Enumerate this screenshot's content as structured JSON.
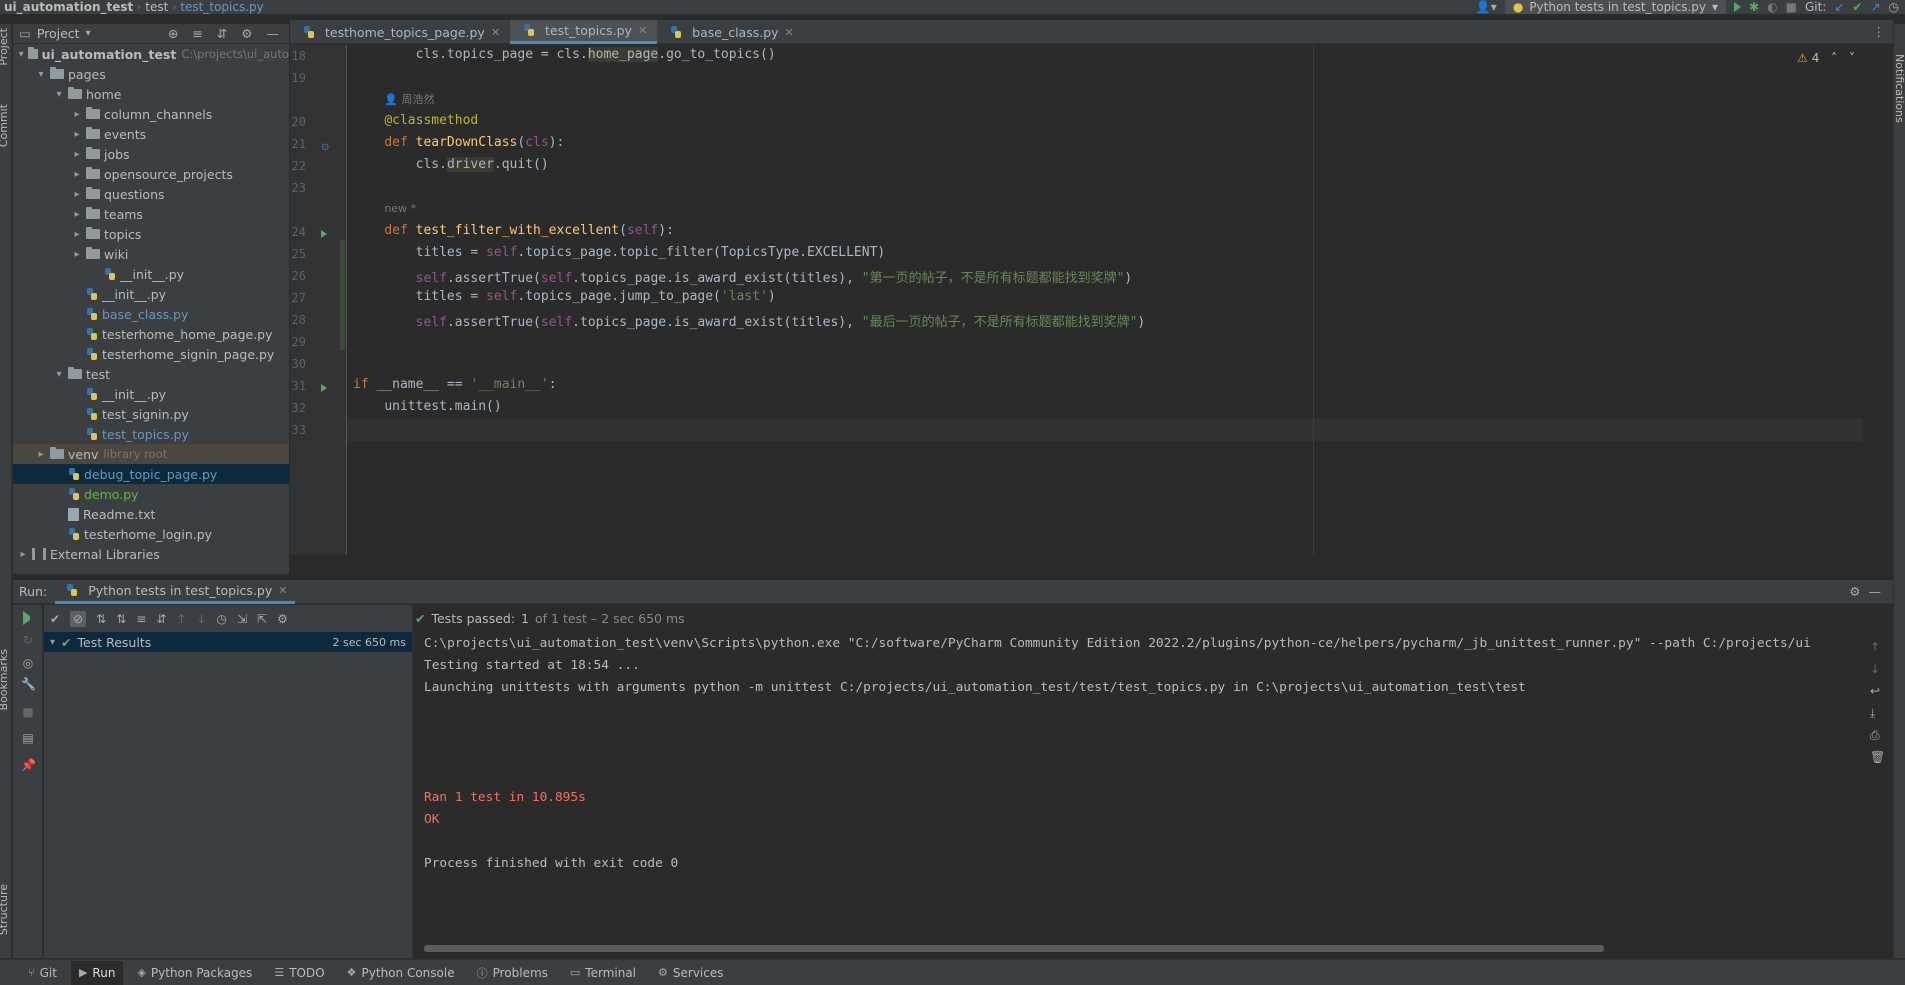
{
  "navbar": {
    "project": "ui_automation_test",
    "folder": "test",
    "file": "test_topics.py",
    "run_config": "Python tests in test_topics.py",
    "git_label": "Git:"
  },
  "left_stripe": {
    "project": "Project",
    "commit": "Commit",
    "bookmarks": "Bookmarks",
    "structure": "Structure"
  },
  "right_stripe": {
    "notifications": "Notifications"
  },
  "project_panel": {
    "title": "Project",
    "root_name": "ui_automation_test",
    "root_path": "C:\\projects\\ui_auto",
    "items": [
      {
        "label": "pages",
        "type": "folder",
        "depth": 1,
        "open": true
      },
      {
        "label": "home",
        "type": "folder",
        "depth": 2,
        "open": true
      },
      {
        "label": "column_channels",
        "type": "folder",
        "depth": 3,
        "open": false
      },
      {
        "label": "events",
        "type": "folder",
        "depth": 3,
        "open": false
      },
      {
        "label": "jobs",
        "type": "folder",
        "depth": 3,
        "open": false
      },
      {
        "label": "opensource_projects",
        "type": "folder",
        "depth": 3,
        "open": false
      },
      {
        "label": "questions",
        "type": "folder",
        "depth": 3,
        "open": false
      },
      {
        "label": "teams",
        "type": "folder",
        "depth": 3,
        "open": false
      },
      {
        "label": "topics",
        "type": "folder",
        "depth": 3,
        "open": false
      },
      {
        "label": "wiki",
        "type": "folder",
        "depth": 3,
        "open": false
      },
      {
        "label": "__init__.py",
        "type": "py",
        "depth": 4
      },
      {
        "label": "__init__.py",
        "type": "py",
        "depth": 3
      },
      {
        "label": "base_class.py",
        "type": "py",
        "depth": 3,
        "color": "blue"
      },
      {
        "label": "testerhome_home_page.py",
        "type": "py",
        "depth": 3
      },
      {
        "label": "testerhome_signin_page.py",
        "type": "py",
        "depth": 3
      },
      {
        "label": "test",
        "type": "folder",
        "depth": 2,
        "open": true
      },
      {
        "label": "__init__.py",
        "type": "py",
        "depth": 3
      },
      {
        "label": "test_signin.py",
        "type": "py",
        "depth": 3
      },
      {
        "label": "test_topics.py",
        "type": "py",
        "depth": 3,
        "color": "blue"
      },
      {
        "label": "venv",
        "type": "folder",
        "depth": 1,
        "open": false,
        "suffix": "library root",
        "state": "highlight"
      },
      {
        "label": "debug_topic_page.py",
        "type": "py",
        "depth": 2,
        "color": "blue",
        "state": "selected"
      },
      {
        "label": "demo.py",
        "type": "py",
        "depth": 2,
        "color": "green"
      },
      {
        "label": "Readme.txt",
        "type": "txt",
        "depth": 2
      },
      {
        "label": "testerhome_login.py",
        "type": "py",
        "depth": 2
      },
      {
        "label": "External Libraries",
        "type": "lib",
        "depth": 0,
        "open": false
      }
    ]
  },
  "editor_tabs": [
    {
      "label": "testhome_topics_page.py",
      "active": false
    },
    {
      "label": "test_topics.py",
      "active": true
    },
    {
      "label": "base_class.py",
      "active": false
    }
  ],
  "editor": {
    "warnings": "4",
    "author_hint": "周浩然",
    "new_hint": "new *",
    "line_numbers": [
      "18",
      "19",
      "20",
      "21",
      "22",
      "23",
      "24",
      "25",
      "26",
      "27",
      "28",
      "29",
      "30",
      "31",
      "32",
      "33"
    ],
    "code": {
      "l18_a": "cls.topics_page = cls.",
      "l18_b": "home_page",
      "l18_c": ".go_to_topics()",
      "l20": "@classmethod",
      "l21_kw": "def ",
      "l21_fn": "tearDownClass",
      "l21_a": "(",
      "l21_self": "cls",
      "l21_b": "):",
      "l22_a": "cls.",
      "l22_b": "driver",
      "l22_c": ".quit()",
      "l24_kw": "def ",
      "l24_fn": "test_filter_with_excellent",
      "l24_a": "(",
      "l24_self": "self",
      "l24_b": "):",
      "l25_a": "titles = ",
      "l25_self": "self",
      "l25_b": ".topics_page.topic_filter(TopicsType.EXCELLENT)",
      "l26_self": "self",
      "l26_a": ".assertTrue(",
      "l26_self2": "self",
      "l26_b": ".topics_page.is_award_exist(titles), ",
      "l26_str": "\"第一页的帖子，不是所有标题都能找到奖牌\"",
      "l26_c": ")",
      "l27_a": "titles = ",
      "l27_self": "self",
      "l27_b": ".topics_page.jump_to_page(",
      "l27_str": "'last'",
      "l27_c": ")",
      "l28_self": "self",
      "l28_a": ".assertTrue(",
      "l28_self2": "self",
      "l28_b": ".topics_page.is_award_exist(titles), ",
      "l28_str": "\"最后一页的帖子，不是所有标题都能找到奖牌\"",
      "l28_c": ")",
      "l31_kw": "if ",
      "l31_a": "__name__ == ",
      "l31_str": "'__main__'",
      "l31_b": ":",
      "l32": "unittest.main()"
    }
  },
  "run_panel": {
    "run_label": "Run:",
    "tab_label": "Python tests in test_topics.py",
    "status_main": "Tests passed:",
    "status_count": "1",
    "status_rest": "of 1 test – 2 sec 650 ms",
    "test_root": "Test Results",
    "test_root_time": "2 sec 650 ms",
    "console": {
      "line1": "C:\\projects\\ui_automation_test\\venv\\Scripts\\python.exe \"C:/software/PyCharm Community Edition 2022.2/plugins/python-ce/helpers/pycharm/_jb_unittest_runner.py\" --path C:/projects/ui",
      "line2": "Testing started at 18:54 ...",
      "line3": "Launching unittests with arguments python -m unittest C:/projects/ui_automation_test/test/test_topics.py in C:\\projects\\ui_automation_test\\test",
      "line4": "Ran 1 test in 10.895s",
      "line5": "OK",
      "line6": "Process finished with exit code 0"
    }
  },
  "bottom_bar": [
    {
      "label": "Git",
      "icon": "git-icon",
      "active": false
    },
    {
      "label": "Run",
      "icon": "run-icon",
      "active": true
    },
    {
      "label": "Python Packages",
      "icon": "packages-icon",
      "active": false
    },
    {
      "label": "TODO",
      "icon": "todo-icon",
      "active": false
    },
    {
      "label": "Python Console",
      "icon": "console-icon",
      "active": false
    },
    {
      "label": "Problems",
      "icon": "problems-icon",
      "active": false
    },
    {
      "label": "Terminal",
      "icon": "terminal-icon",
      "active": false
    },
    {
      "label": "Services",
      "icon": "services-icon",
      "active": false
    }
  ],
  "colors": {
    "accent": "#4a88c7",
    "pass": "#59a869",
    "error_text": "#f0725c",
    "background": "#2b2b2b",
    "panel": "#3c3f41"
  }
}
